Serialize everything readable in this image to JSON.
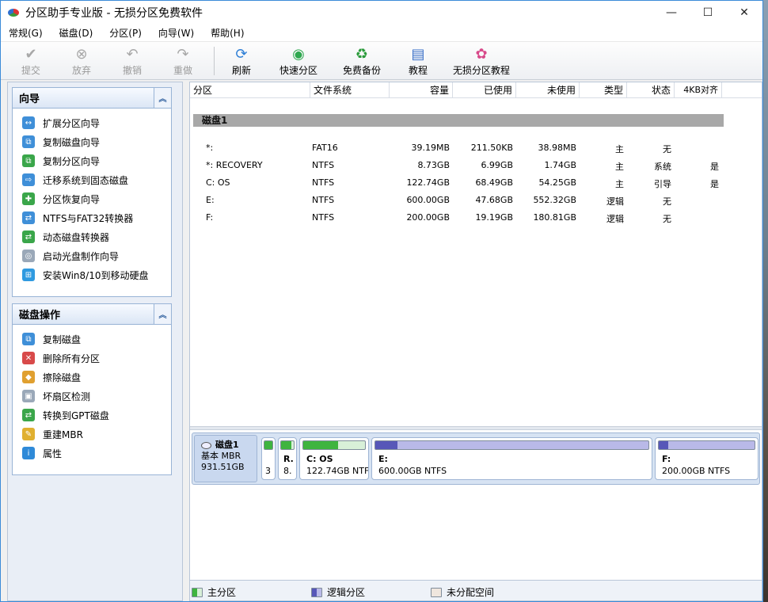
{
  "window": {
    "title": "分区助手专业版 - 无损分区免费软件",
    "minimize": "—",
    "maximize": "☐",
    "close": "✕"
  },
  "menu": [
    "常规(G)",
    "磁盘(D)",
    "分区(P)",
    "向导(W)",
    "帮助(H)"
  ],
  "toolbar": {
    "submit": "提交",
    "discard": "放弃",
    "undo": "撤销",
    "redo": "重做",
    "refresh": "刷新",
    "quick_partition": "快速分区",
    "free_backup": "免费备份",
    "tutorial": "教程",
    "tutorial2": "无损分区教程"
  },
  "wizard_panel": {
    "title": "向导",
    "items": [
      "扩展分区向导",
      "复制磁盘向导",
      "复制分区向导",
      "迁移系统到固态磁盘",
      "分区恢复向导",
      "NTFS与FAT32转换器",
      "动态磁盘转换器",
      "启动光盘制作向导",
      "安装Win8/10到移动硬盘"
    ]
  },
  "disk_ops_panel": {
    "title": "磁盘操作",
    "items": [
      "复制磁盘",
      "删除所有分区",
      "擦除磁盘",
      "坏扇区检测",
      "转换到GPT磁盘",
      "重建MBR",
      "属性"
    ]
  },
  "grid": {
    "headers": [
      "分区",
      "文件系统",
      "容量",
      "已使用",
      "未使用",
      "类型",
      "状态",
      "4KB对齐"
    ],
    "disk_label": "磁盘1",
    "rows": [
      {
        "name": "*:",
        "fs": "FAT16",
        "cap": "39.19MB",
        "used": "211.50KB",
        "free": "38.98MB",
        "type": "主",
        "status": "无",
        "align": ""
      },
      {
        "name": "*: RECOVERY",
        "fs": "NTFS",
        "cap": "8.73GB",
        "used": "6.99GB",
        "free": "1.74GB",
        "type": "主",
        "status": "系统",
        "align": "是"
      },
      {
        "name": "C: OS",
        "fs": "NTFS",
        "cap": "122.74GB",
        "used": "68.49GB",
        "free": "54.25GB",
        "type": "主",
        "status": "引导",
        "align": "是"
      },
      {
        "name": "E:",
        "fs": "NTFS",
        "cap": "600.00GB",
        "used": "47.68GB",
        "free": "552.32GB",
        "type": "逻辑",
        "status": "无",
        "align": ""
      },
      {
        "name": "F:",
        "fs": "NTFS",
        "cap": "200.00GB",
        "used": "19.19GB",
        "free": "180.81GB",
        "type": "逻辑",
        "status": "无",
        "align": ""
      }
    ]
  },
  "diskmap": {
    "disk_name": "磁盘1",
    "disk_type": "基本 MBR",
    "disk_size": "931.51GB",
    "parts": [
      {
        "name": "",
        "size": "3",
        "kind": "primary",
        "used_pct": 100
      },
      {
        "name": "R.",
        "size": "8.",
        "kind": "primary",
        "used_pct": 80
      },
      {
        "name": "C: OS",
        "size": "122.74GB NTFS",
        "kind": "primary",
        "used_pct": 56
      },
      {
        "name": "E:",
        "size": "600.00GB NTFS",
        "kind": "logical",
        "used_pct": 8
      },
      {
        "name": "F:",
        "size": "200.00GB NTFS",
        "kind": "logical",
        "used_pct": 10
      }
    ]
  },
  "legend": {
    "primary": "主分区",
    "logical": "逻辑分区",
    "unallocated": "未分配空间"
  },
  "colors": {
    "primary": "#3fb43f",
    "logical": "#5757b8",
    "unallocated": "#efe6de",
    "accent": "#3b8bd8"
  }
}
